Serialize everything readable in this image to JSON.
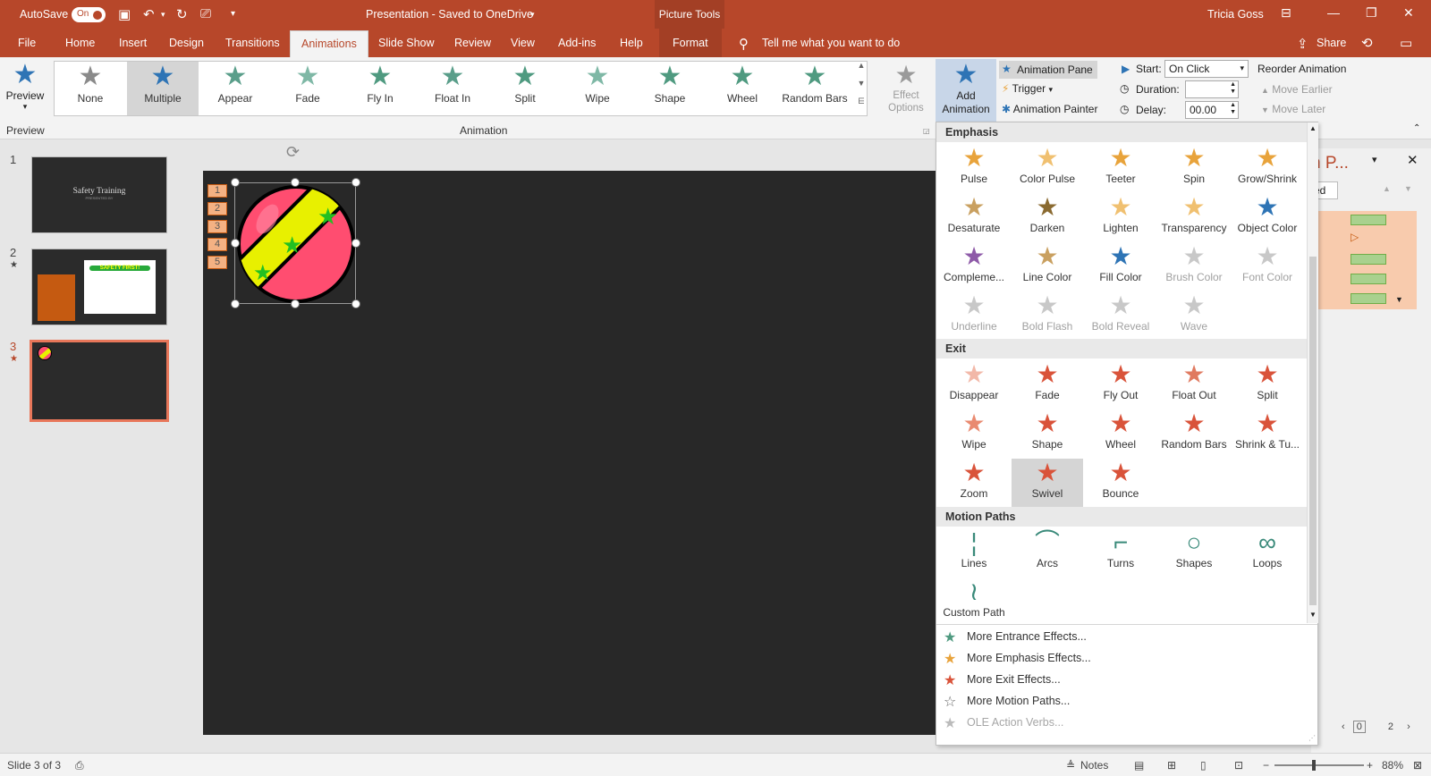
{
  "titlebar": {
    "autosave_label": "AutoSave",
    "autosave_state": "On",
    "document_title": "Presentation - Saved to OneDrive",
    "context_tab_group": "Picture Tools",
    "user_name": "Tricia Goss"
  },
  "tabs": [
    "File",
    "Home",
    "Insert",
    "Design",
    "Transitions",
    "Animations",
    "Slide Show",
    "Review",
    "View",
    "Add-ins",
    "Help",
    "Format"
  ],
  "active_tab": "Animations",
  "tell_me": "Tell me what you want to do",
  "share": "Share",
  "ribbon": {
    "preview_label": "Preview",
    "preview_group": "Preview",
    "animation_group": "Animation",
    "gallery": [
      {
        "label": "None",
        "color": "#8a8a8a"
      },
      {
        "label": "Multiple",
        "color": "#2e74b5"
      },
      {
        "label": "Appear",
        "color": "#5a9e8a"
      },
      {
        "label": "Fade",
        "color": "#7fb8a6"
      },
      {
        "label": "Fly In",
        "color": "#4f9a80"
      },
      {
        "label": "Float In",
        "color": "#5a9e8a"
      },
      {
        "label": "Split",
        "color": "#4f9a80"
      },
      {
        "label": "Wipe",
        "color": "#7fb8a6"
      },
      {
        "label": "Shape",
        "color": "#4f9a80"
      },
      {
        "label": "Wheel",
        "color": "#4f9a80"
      },
      {
        "label": "Random Bars",
        "color": "#4f9a80"
      }
    ],
    "effect_options": "Effect Options",
    "add_animation": "Add Animation",
    "animation_pane": "Animation Pane",
    "trigger": "Trigger",
    "animation_painter": "Animation Painter",
    "start_label": "Start:",
    "start_value": "On Click",
    "duration_label": "Duration:",
    "duration_value": "",
    "delay_label": "Delay:",
    "delay_value": "00.00",
    "reorder": "Reorder Animation",
    "move_earlier": "Move Earlier",
    "move_later": "Move Later"
  },
  "slides": [
    {
      "num": "1",
      "title": "Safety Training",
      "subtitle": "PRESENTED BY"
    },
    {
      "num": "2",
      "callout": "SAFETY FIRST!"
    },
    {
      "num": "3"
    }
  ],
  "slide_tags": [
    "1",
    "2",
    "3",
    "4",
    "5"
  ],
  "dropdown": {
    "emphasis_header": "Emphasis",
    "emphasis": [
      {
        "label": "Pulse",
        "color": "#e8a33b",
        "disabled": false
      },
      {
        "label": "Color Pulse",
        "color": "#f0c070",
        "disabled": false
      },
      {
        "label": "Teeter",
        "color": "#e8a33b",
        "disabled": false
      },
      {
        "label": "Spin",
        "color": "#e8a33b",
        "disabled": false
      },
      {
        "label": "Grow/Shrink",
        "color": "#e8a33b",
        "disabled": false
      },
      {
        "label": "Desaturate",
        "color": "#c9a060",
        "disabled": false
      },
      {
        "label": "Darken",
        "color": "#8a6a30",
        "disabled": false
      },
      {
        "label": "Lighten",
        "color": "#f0c070",
        "disabled": false
      },
      {
        "label": "Transparency",
        "color": "#f0c070",
        "disabled": false
      },
      {
        "label": "Object Color",
        "color": "#2e74b5",
        "disabled": false
      },
      {
        "label": "Compleme...",
        "color": "#8e5aa8",
        "disabled": false
      },
      {
        "label": "Line Color",
        "color": "#c9a060",
        "disabled": false
      },
      {
        "label": "Fill Color",
        "color": "#2e74b5",
        "disabled": false
      },
      {
        "label": "Brush Color",
        "color": "#c8c8c8",
        "disabled": true
      },
      {
        "label": "Font Color",
        "color": "#c8c8c8",
        "disabled": true
      },
      {
        "label": "Underline",
        "color": "#c8c8c8",
        "disabled": true
      },
      {
        "label": "Bold Flash",
        "color": "#c8c8c8",
        "disabled": true
      },
      {
        "label": "Bold Reveal",
        "color": "#c8c8c8",
        "disabled": true
      },
      {
        "label": "Wave",
        "color": "#c8c8c8",
        "disabled": true
      }
    ],
    "exit_header": "Exit",
    "exit": [
      {
        "label": "Disappear",
        "color": "#f2b8a8"
      },
      {
        "label": "Fade",
        "color": "#d9533a"
      },
      {
        "label": "Fly Out",
        "color": "#d9533a"
      },
      {
        "label": "Float Out",
        "color": "#e07a60"
      },
      {
        "label": "Split",
        "color": "#d9533a"
      },
      {
        "label": "Wipe",
        "color": "#e98a70"
      },
      {
        "label": "Shape",
        "color": "#d9533a"
      },
      {
        "label": "Wheel",
        "color": "#d9533a"
      },
      {
        "label": "Random Bars",
        "color": "#d9533a"
      },
      {
        "label": "Shrink & Tu...",
        "color": "#d9533a"
      },
      {
        "label": "Zoom",
        "color": "#d9533a"
      },
      {
        "label": "Swivel",
        "color": "#d9533a"
      },
      {
        "label": "Bounce",
        "color": "#d9533a"
      }
    ],
    "motion_header": "Motion Paths",
    "motion": [
      {
        "label": "Lines",
        "glyph": "¦"
      },
      {
        "label": "Arcs",
        "glyph": "⌒"
      },
      {
        "label": "Turns",
        "glyph": "⌐"
      },
      {
        "label": "Shapes",
        "glyph": "○"
      },
      {
        "label": "Loops",
        "glyph": "∞"
      },
      {
        "label": "Custom Path",
        "glyph": "≀"
      }
    ],
    "more": [
      {
        "label": "More Entrance Effects...",
        "color": "#4f9a80",
        "disabled": false
      },
      {
        "label": "More Emphasis Effects...",
        "color": "#e8a33b",
        "disabled": false
      },
      {
        "label": "More Exit Effects...",
        "color": "#d9533a",
        "disabled": false
      },
      {
        "label": "More Motion Paths...",
        "color": "#666666",
        "disabled": false
      },
      {
        "label": "OLE Action Verbs...",
        "color": "#bbbbbb",
        "disabled": true
      }
    ]
  },
  "pane_partial_title": "n P...",
  "pane_partial_button": "ed",
  "status": {
    "slide_indicator": "Slide 3 of 3",
    "notes": "Notes",
    "zoom": "88%",
    "page_box": "0",
    "page_total": "2"
  },
  "colors": {
    "accent": "#b7472a",
    "ribbon_bg": "#f3f3f3",
    "slide_bg": "#282828"
  }
}
